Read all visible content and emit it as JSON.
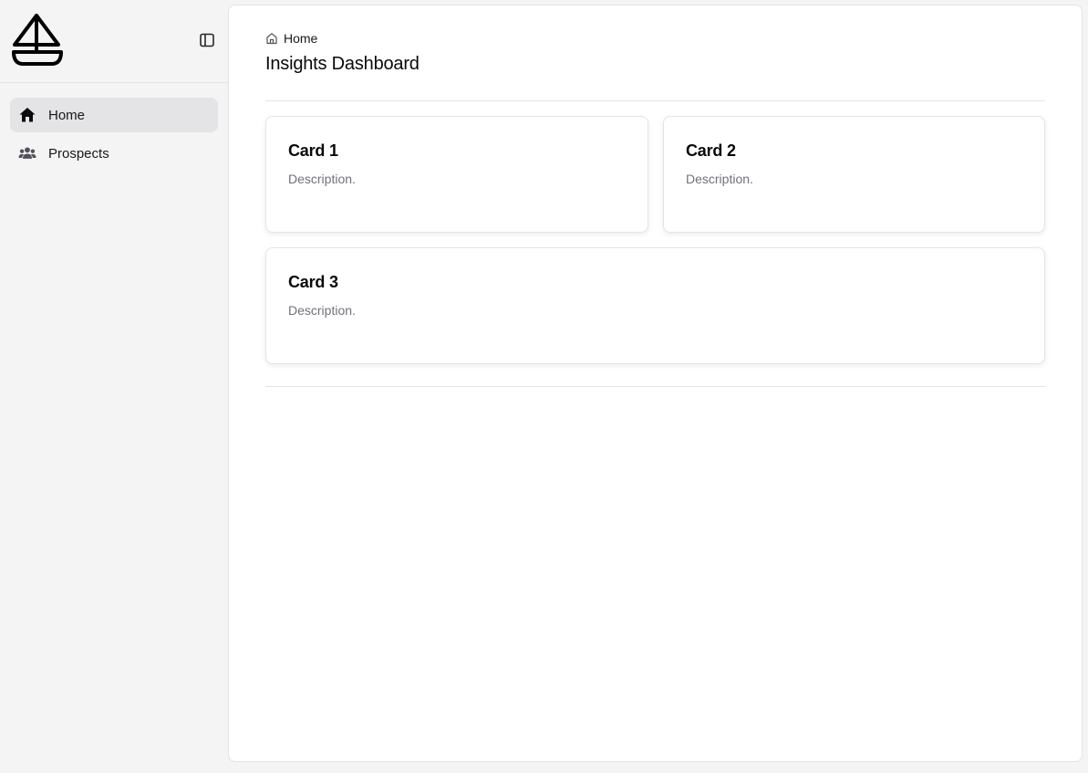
{
  "sidebar": {
    "logo_icon": "sailboat-icon",
    "toggle_icon": "sidebar-toggle-icon",
    "items": [
      {
        "label": "Home",
        "icon": "home-icon",
        "active": true
      },
      {
        "label": "Prospects",
        "icon": "users-icon",
        "active": false
      }
    ]
  },
  "main": {
    "breadcrumb": {
      "label": "Home",
      "icon": "home-outline-icon"
    },
    "title": "Insights Dashboard",
    "cards": [
      {
        "title": "Card 1",
        "description": "Description."
      },
      {
        "title": "Card 2",
        "description": "Description."
      },
      {
        "title": "Card 3",
        "description": "Description."
      }
    ]
  },
  "colors": {
    "sidebar_bg": "#f4f4f5",
    "active_item_bg": "#e4e4e7",
    "muted_text": "#71717a",
    "border": "#e4e4e7"
  }
}
